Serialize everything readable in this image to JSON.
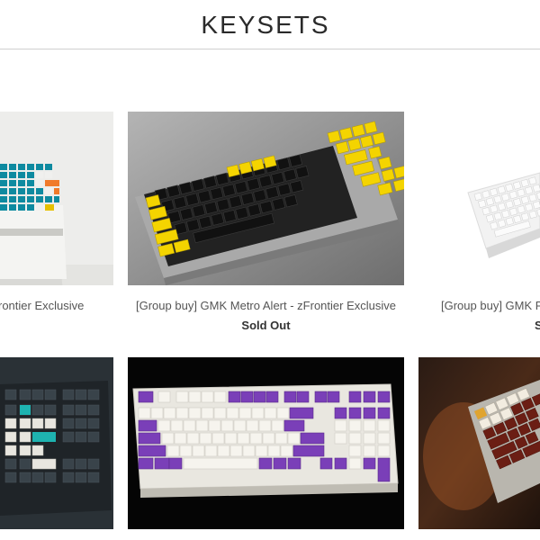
{
  "collection": {
    "title": "KEYSETS"
  },
  "products": [
    {
      "title": "rontier Exclusive",
      "status": ""
    },
    {
      "title": "[Group buy] GMK Metro Alert - zFrontier Exclusive",
      "status": "Sold Out"
    },
    {
      "title": "[Group buy] GMK Pr",
      "status": "S"
    },
    {
      "title": "",
      "status": ""
    },
    {
      "title": "",
      "status": ""
    },
    {
      "title": "",
      "status": ""
    }
  ]
}
